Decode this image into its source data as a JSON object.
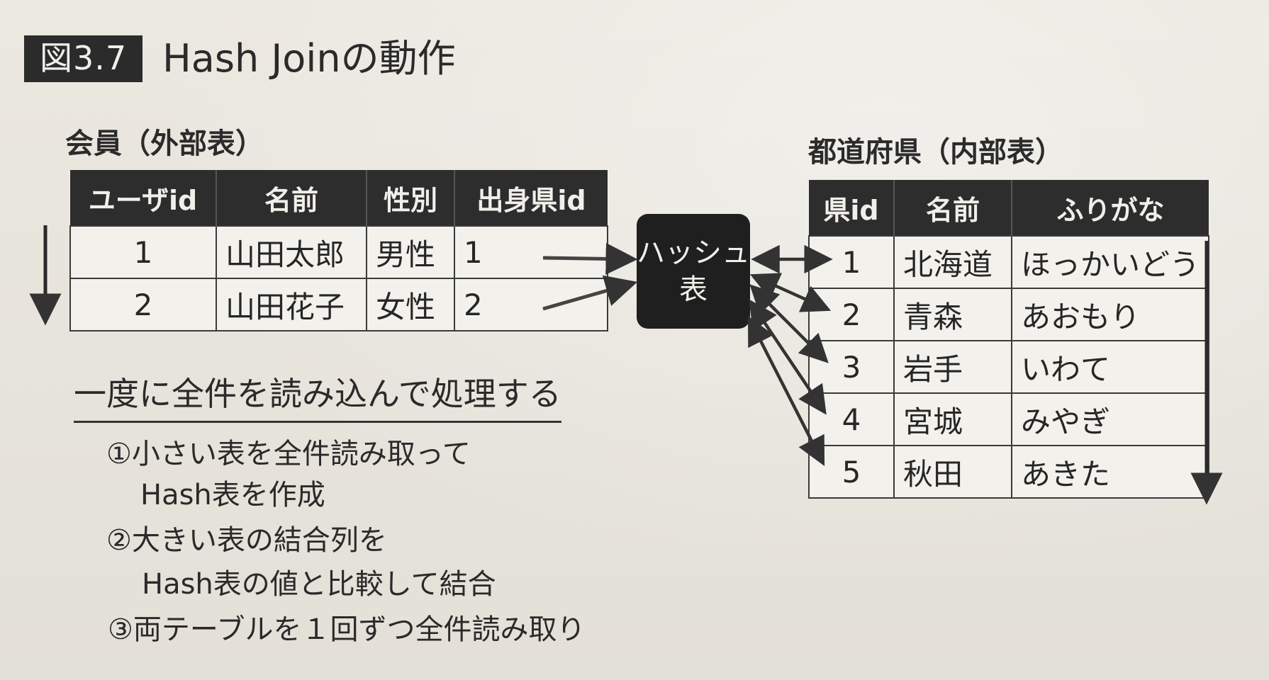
{
  "figure": {
    "badge": "図3.7",
    "title": "Hash Joinの動作"
  },
  "outer_table": {
    "caption": "会員（外部表）",
    "headers": [
      "ユーザid",
      "名前",
      "性別",
      "出身県id"
    ],
    "rows": [
      [
        "1",
        "山田太郎",
        "男性",
        "1"
      ],
      [
        "2",
        "山田花子",
        "女性",
        "2"
      ]
    ]
  },
  "hash_table": {
    "line1": "ハッシュ",
    "line2": "表"
  },
  "inner_table": {
    "caption": "都道府県（内部表）",
    "headers": [
      "県id",
      "名前",
      "ふりがな"
    ],
    "rows": [
      [
        "1",
        "北海道",
        "ほっかいどう"
      ],
      [
        "2",
        "青森",
        "あおもり"
      ],
      [
        "3",
        "岩手",
        "いわて"
      ],
      [
        "4",
        "宮城",
        "みやぎ"
      ],
      [
        "5",
        "秋田",
        "あきた"
      ]
    ]
  },
  "notes": {
    "heading": "一度に全件を読み込んで処理する",
    "step1a": "①小さい表を全件読み取って",
    "step1b": "Hash表を作成",
    "step2a": "②大きい表の結合列を",
    "step2b": "Hash表の値と比較して結合",
    "step3": "③両テーブルを１回ずつ全件読み取り"
  },
  "colors": {
    "header_bg": "#2d2d2d",
    "page_bg": "#e8e5dd",
    "ink": "#222222"
  }
}
